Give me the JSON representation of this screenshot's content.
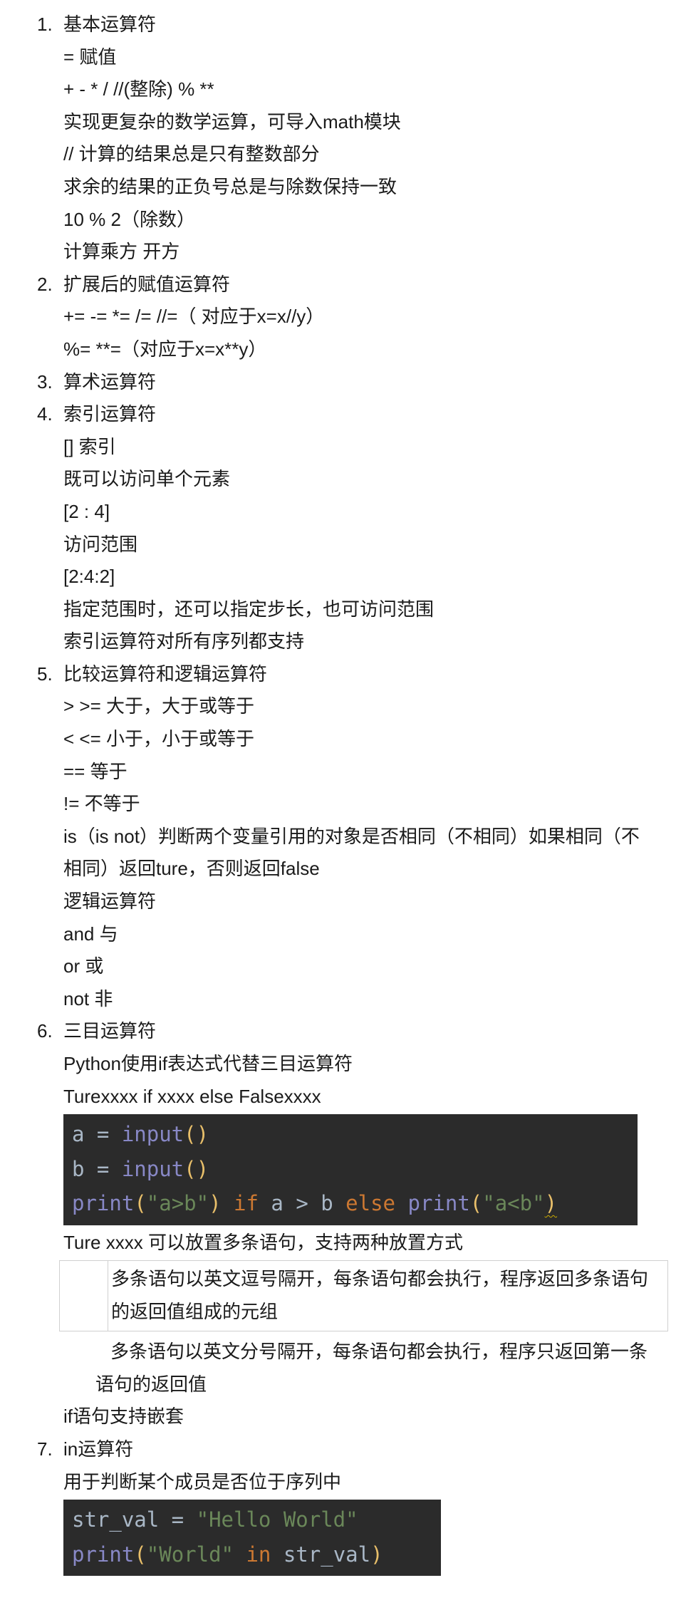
{
  "sections": [
    {
      "num": "1.",
      "title": "基本运算符",
      "lines": [
        "= 赋值",
        "+ - * /  //(整除) % **",
        "实现更复杂的数学运算，可导入math模块",
        "// 计算的结果总是只有整数部分",
        "求余的结果的正负号总是与除数保持一致",
        "10 % 2（除数）",
        "计算乘方 开方"
      ]
    },
    {
      "num": "2.",
      "title": "扩展后的赋值运算符",
      "lines": [
        "+=   -=   *=   /=  //=（ 对应于x=x//y）",
        "%=   **=（对应于x=x**y）"
      ]
    },
    {
      "num": "3.",
      "title": "算术运算符",
      "lines": []
    },
    {
      "num": "4.",
      "title": "索引运算符",
      "lines": [
        "[] 索引",
        "既可以访问单个元素",
        "[2 : 4]",
        "访问范围",
        "[2:4:2]",
        "指定范围时，还可以指定步长，也可访问范围",
        "索引运算符对所有序列都支持"
      ]
    },
    {
      "num": "5.",
      "title": "比较运算符和逻辑运算符",
      "lines": [
        " > >=  大于，大于或等于",
        "< <=   小于，小于或等于",
        "== 等于",
        "!= 不等于",
        "is（is not）判断两个变量引用的对象是否相同（不相同）如果相同（不",
        "相同）返回ture，否则返回false",
        "逻辑运算符",
        "and 与",
        "or 或",
        "not 非"
      ]
    }
  ],
  "section6": {
    "num": "6.",
    "title": "三目运算符",
    "lines": [
      "Python使用if表达式代替三目运算符",
      "Turexxxx if xxxx else Falsexxxx"
    ],
    "code": [
      [
        {
          "t": "a = ",
          "k": "plain"
        },
        {
          "t": "input",
          "k": "builtin"
        },
        {
          "t": "()",
          "k": "paren"
        }
      ],
      [
        {
          "t": "b = ",
          "k": "plain"
        },
        {
          "t": "input",
          "k": "builtin"
        },
        {
          "t": "()",
          "k": "paren"
        }
      ],
      [
        {
          "t": "print",
          "k": "builtin"
        },
        {
          "t": "(",
          "k": "paren"
        },
        {
          "t": "\"a>b\"",
          "k": "string"
        },
        {
          "t": ")",
          "k": "paren"
        },
        {
          "t": " ",
          "k": "plain"
        },
        {
          "t": "if",
          "k": "keyword"
        },
        {
          "t": " a > b ",
          "k": "plain"
        },
        {
          "t": "else",
          "k": "keyword"
        },
        {
          "t": " ",
          "k": "plain"
        },
        {
          "t": "print",
          "k": "builtin"
        },
        {
          "t": "(",
          "k": "paren"
        },
        {
          "t": "\"a<b\"",
          "k": "string"
        },
        {
          "t": ")",
          "k": "paren",
          "squiggle": true
        }
      ]
    ],
    "after_code": "Ture xxxx 可以放置多条语句，支持两种放置方式",
    "table_cell": [
      "多条语句以英文逗号隔开，每条语句都会执行，程序返回多条语句",
      "的返回值组成的元组"
    ],
    "para": [
      "多条语句以英文分号隔开，每条语句都会执行，程序只返回第一条",
      "语句的返回值"
    ],
    "last": "if语句支持嵌套"
  },
  "section7": {
    "num": "7.",
    "title": "in运算符",
    "lines": [
      "用于判断某个成员是否位于序列中"
    ],
    "code": [
      [
        {
          "t": "str_val = ",
          "k": "plain"
        },
        {
          "t": "\"Hello World\"",
          "k": "string"
        }
      ],
      [
        {
          "t": "print",
          "k": "builtin"
        },
        {
          "t": "(",
          "k": "paren"
        },
        {
          "t": "\"World\"",
          "k": "string"
        },
        {
          "t": " ",
          "k": "plain"
        },
        {
          "t": "in",
          "k": "keyword"
        },
        {
          "t": " str_val",
          "k": "plain"
        },
        {
          "t": ")",
          "k": "paren"
        }
      ]
    ]
  },
  "colors": {
    "code_bg": "#2b2b2b",
    "plain": "#a9b7c6",
    "builtin": "#8888c6",
    "paren": "#e8bf6a",
    "keyword": "#cc7832",
    "string": "#6a8759"
  }
}
